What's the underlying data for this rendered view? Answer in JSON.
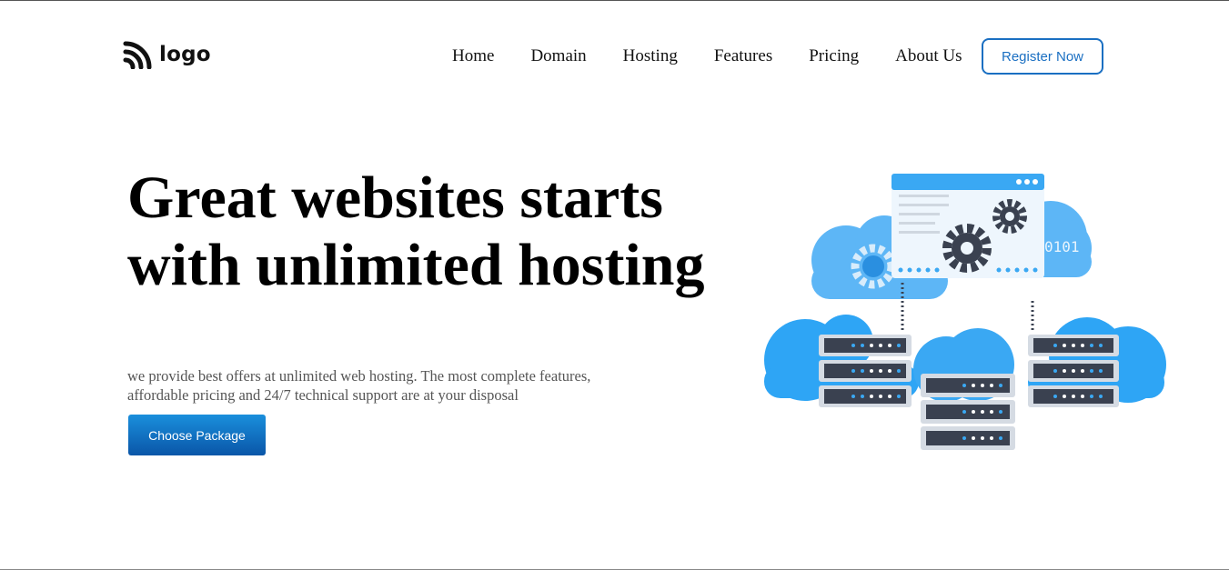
{
  "header": {
    "logo_text": "logo",
    "logo_icon": "rss-feed-icon",
    "nav": [
      "Home",
      "Domain",
      "Hosting",
      "Features",
      "Pricing",
      "About Us"
    ],
    "register_label": "Register Now"
  },
  "hero": {
    "title": "Great websites starts with unlimited hosting",
    "description": "we provide best offers at unlimited web hosting. The most complete features, affordable pricing and 24/7 technical support are at your disposal",
    "cta_label": "Choose Package"
  },
  "illustration": {
    "binary_text": "0101",
    "icons": [
      "cloud-icon",
      "server-rack-icon",
      "gear-icon",
      "browser-window-icon"
    ]
  },
  "colors": {
    "accent": "#1a6fc2",
    "cta_top": "#1a8fdc",
    "cta_bottom": "#0a56a8",
    "cloud": "#2ea5f5",
    "server": "#3a4150"
  }
}
